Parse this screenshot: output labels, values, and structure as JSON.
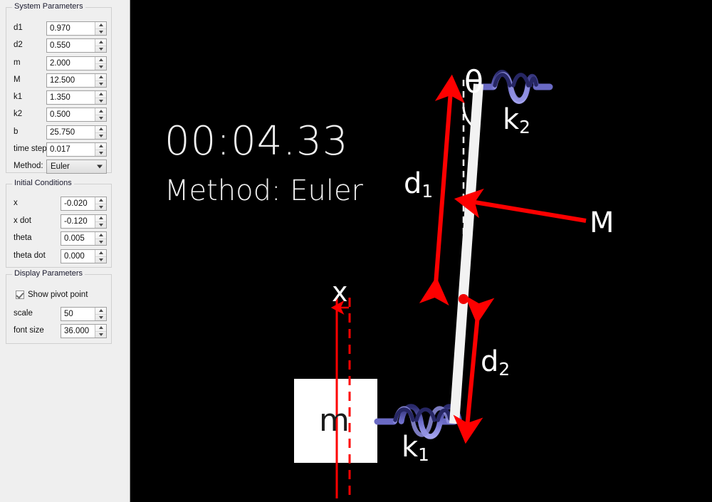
{
  "panel": {
    "system_parameters": {
      "title": "System Parameters",
      "fields": [
        {
          "label": "d1",
          "value": "0.970"
        },
        {
          "label": "d2",
          "value": "0.550"
        },
        {
          "label": "m",
          "value": "2.000"
        },
        {
          "label": "M",
          "value": "12.500"
        },
        {
          "label": "k1",
          "value": "1.350"
        },
        {
          "label": "k2",
          "value": "0.500"
        },
        {
          "label": "b",
          "value": "25.750"
        },
        {
          "label": "time step",
          "value": "0.017"
        }
      ],
      "method_label": "Method:",
      "method_value": "Euler"
    },
    "initial_conditions": {
      "title": "Initial Conditions",
      "fields": [
        {
          "label": "x",
          "value": "-0.020"
        },
        {
          "label": "x dot",
          "value": "-0.120"
        },
        {
          "label": "theta",
          "value": "0.005"
        },
        {
          "label": "theta dot",
          "value": "0.000"
        }
      ]
    },
    "display_parameters": {
      "title": "Display Parameters",
      "show_pivot_label": "Show pivot point",
      "show_pivot_checked": true,
      "fields": [
        {
          "label": "scale",
          "value": "50"
        },
        {
          "label": "font size",
          "value": "36.000"
        }
      ]
    }
  },
  "canvas": {
    "timer": "00:04.33",
    "method_text": "Method: Euler",
    "labels": {
      "theta": "θ",
      "k1_base": "k",
      "k1_sub": "1",
      "k2_base": "k",
      "k2_sub": "2",
      "d1_base": "d",
      "d1_sub": "1",
      "d2_base": "d",
      "d2_sub": "2",
      "mass_M": "M",
      "mass_m": "m",
      "displacement_x": "x"
    },
    "colors": {
      "background": "#000000",
      "rod": "#f2f2f2",
      "mass_block": "#ffffff",
      "annotation": "#fe0000",
      "spring_light": "#8f8fe0",
      "spring_dark": "#262663",
      "pivot": "#f00000",
      "text": "#ffffff"
    }
  }
}
